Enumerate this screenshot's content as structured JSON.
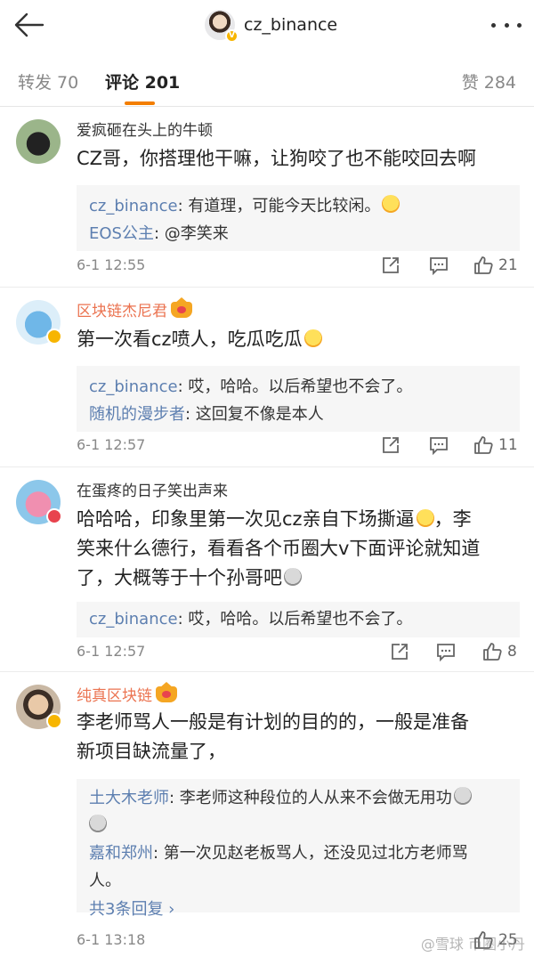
{
  "header": {
    "title": "cz_binance",
    "verified_badge": "V"
  },
  "tabs": {
    "repost": "转发 70",
    "comments": "评论 201",
    "likes": "赞 284"
  },
  "comments": [
    {
      "user": "爱疯砸在头上的牛顿",
      "text": "CZ哥，你搭理他干嘛，让狗咬了也不能咬回去啊",
      "replies": [
        {
          "name": "cz_binance",
          "text": ": 有道理，可能今天比较闲。"
        },
        {
          "name": "EOS公主",
          "text": ": @李笑来"
        }
      ],
      "time": "6-1 12:55",
      "likes": "21"
    },
    {
      "user": "区块链杰尼君",
      "text": "第一次看cz喷人，吃瓜吃瓜",
      "replies": [
        {
          "name": "cz_binance",
          "text": ": 哎，哈哈。以后希望也不会了。"
        },
        {
          "name": "随机的漫步者",
          "text": ": 这回复不像是本人"
        }
      ],
      "time": "6-1 12:57",
      "likes": "11"
    },
    {
      "user": "在蛋疼的日子笑出声来",
      "text_lines": [
        "哈哈哈，印象里第一次见cz亲自下场撕逼",
        "，李",
        "笑来什么德行，看看各个币圈大v下面评论就知道",
        "了，大概等于十个孙哥吧"
      ],
      "replies": [
        {
          "name": "cz_binance",
          "text": ": 哎，哈哈。以后希望也不会了。"
        }
      ],
      "time": "6-1 12:57",
      "likes": "8"
    },
    {
      "user": "纯真区块链",
      "text_lines": [
        "李老师骂人一般是有计划的目的的，一般是准备",
        "新项目缺流量了，"
      ],
      "replies": [
        {
          "name": "土大木老师",
          "text": ": 李老师这种段位的人从来不会做无用功"
        },
        {
          "name": "嘉和郑州",
          "text": ": 第一次见赵老板骂人，还没见过北方老师骂",
          "cont": "人。"
        }
      ],
      "more_replies": "共3条回复 ›",
      "time": "6-1 13:18",
      "likes": "25"
    }
  ],
  "watermark": "@雪球 币圈小丹"
}
